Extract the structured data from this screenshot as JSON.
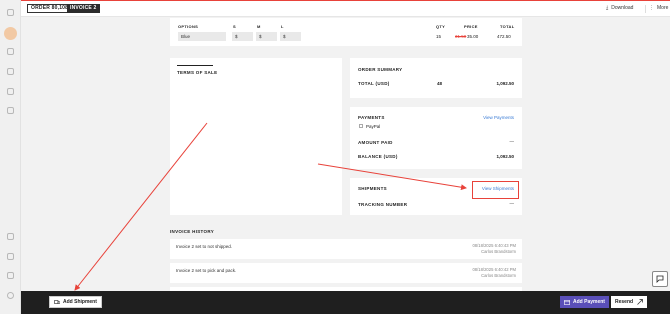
{
  "header": {
    "order_badge": "ORDER 80,108",
    "invoice_badge": "INVOICE 2",
    "download_label": "Download",
    "more_label": "More",
    "download_glyph": "⤓",
    "more_glyph": "⋮"
  },
  "options_table": {
    "headers": {
      "options": "OPTIONS",
      "s": "S",
      "m": "M",
      "l": "L",
      "qty": "QTY",
      "price": "PRICE",
      "total": "TOTAL"
    },
    "row": {
      "option": "Blue",
      "s": "$",
      "m": "$",
      "l": "$",
      "qty": "15",
      "old_price": "31.50",
      "price": "35.00",
      "total": "472.50"
    }
  },
  "terms_of_sale": {
    "title": "TERMS OF SALE"
  },
  "order_summary": {
    "title": "ORDER SUMMARY",
    "total_label": "TOTAL (USD)",
    "total_qty": "48",
    "total_value": "1,092.50"
  },
  "payments": {
    "title": "PAYMENTS",
    "view_link": "View Payments",
    "method": "PayPal",
    "amount_paid_label": "AMOUNT PAID",
    "amount_paid_value": "—",
    "balance_label": "BALANCE (USD)",
    "balance_value": "1,092.50"
  },
  "shipments": {
    "title": "SHIPMENTS",
    "view_link": "View Shipments",
    "tracking_label": "TRACKING NUMBER",
    "tracking_value": "—"
  },
  "invoice_history": {
    "title": "INVOICE HISTORY",
    "entries": [
      {
        "text": "Invoice 2 set to not shipped.",
        "date": "08/18/2025 6:40:43 PM",
        "user": "Carlos Brandstorm"
      },
      {
        "text": "Invoice 2 set to pick and pack.",
        "date": "08/18/2025 6:40:42 PM",
        "user": "Carlos Brandstorm"
      }
    ]
  },
  "bottom_bar": {
    "add_shipment_label": "Add Shipment",
    "add_payment_label": "Add Payment",
    "resend_label": "Resend"
  },
  "colors": {
    "accent": "#e8423a",
    "link": "#3a7bd5",
    "payment_button": "#5a4fb8",
    "bottom_bar": "#1f1f1f"
  },
  "icons": {
    "chat": "chat-icon",
    "ship": "ship-icon",
    "card": "credit-card-icon",
    "send": "send-icon"
  }
}
